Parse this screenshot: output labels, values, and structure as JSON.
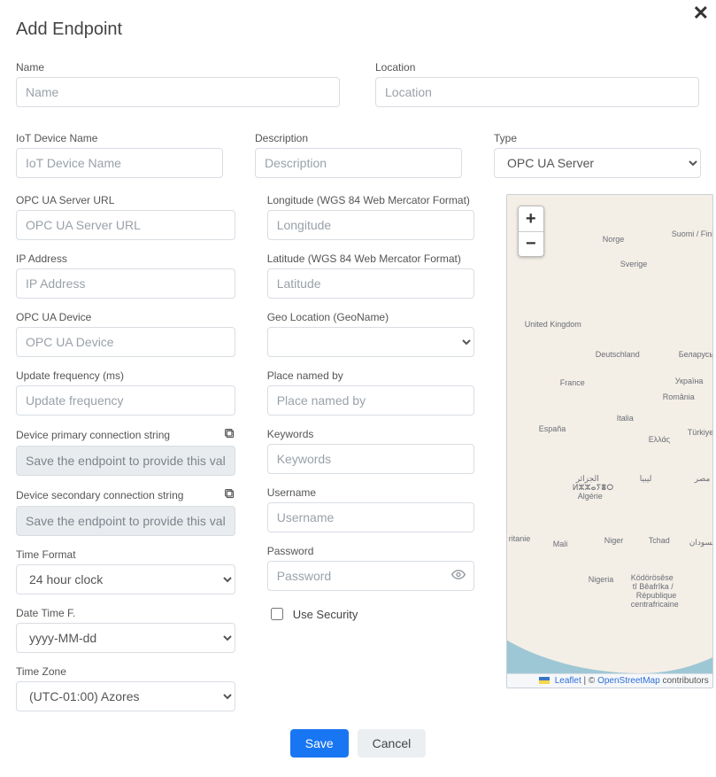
{
  "modal": {
    "title": "Add Endpoint"
  },
  "row1": {
    "name": {
      "label": "Name",
      "placeholder": "Name"
    },
    "location": {
      "label": "Location",
      "placeholder": "Location"
    }
  },
  "row2": {
    "iot": {
      "label": "IoT Device Name",
      "placeholder": "IoT Device Name"
    },
    "desc": {
      "label": "Description",
      "placeholder": "Description"
    },
    "type": {
      "label": "Type",
      "selected": "OPC UA Server"
    }
  },
  "left": {
    "url": {
      "label": "OPC UA Server URL",
      "placeholder": "OPC UA Server URL"
    },
    "ip": {
      "label": "IP Address",
      "placeholder": "IP Address"
    },
    "device": {
      "label": "OPC UA Device",
      "placeholder": "OPC UA Device"
    },
    "freq": {
      "label": "Update frequency (ms)",
      "placeholder": "Update frequency"
    },
    "prim": {
      "label": "Device primary connection string",
      "value": "Save the endpoint to provide this val"
    },
    "sec": {
      "label": "Device secondary connection string",
      "value": "Save the endpoint to provide this val"
    },
    "timefmt": {
      "label": "Time Format",
      "selected": "24 hour clock"
    },
    "datefmt": {
      "label": "Date Time F.",
      "selected": "yyyy-MM-dd"
    },
    "tz": {
      "label": "Time Zone",
      "selected": "(UTC-01:00) Azores"
    }
  },
  "mid": {
    "lon": {
      "label": "Longitude (WGS 84 Web Mercator Format)",
      "placeholder": "Longitude"
    },
    "lat": {
      "label": "Latitude (WGS 84 Web Mercator Format)",
      "placeholder": "Latitude"
    },
    "geo": {
      "label": "Geo Location (GeoName)"
    },
    "place": {
      "label": "Place named by",
      "placeholder": "Place named by"
    },
    "kw": {
      "label": "Keywords",
      "placeholder": "Keywords"
    },
    "user": {
      "label": "Username",
      "placeholder": "Username"
    },
    "pass": {
      "label": "Password",
      "placeholder": "Password"
    },
    "sec": {
      "label": "Use Security"
    }
  },
  "map": {
    "zoom_in": "+",
    "zoom_out": "−",
    "attrib_leaflet": "Leaflet",
    "attrib_sep": " | © ",
    "attrib_osm": "OpenStreetMap",
    "attrib_tail": " contributors",
    "labels": {
      "norge": "Norge",
      "suomi": "Suomi / Finland",
      "sverige": "Sverige",
      "uk": "United Kingdom",
      "de": "Deutschland",
      "be": "Беларусь",
      "fr": "France",
      "ua": "Україна",
      "ro": "România",
      "es": "España",
      "it": "Italia",
      "gr": "Ελλάς",
      "tr": "Türkiye",
      "dz_ar": "الجزائر",
      "dz_tif": "ⵍⵣⵣⴰⵢⴻⵔ",
      "dz_fr": "Algérie",
      "ly": "ليبيا",
      "eg": "مصر",
      "mr": "ritanie",
      "ml": "Mali",
      "ne": "Niger",
      "td": "Tchad",
      "sd": "السودان",
      "ng": "Nigeria",
      "cf1": "Ködörösêse",
      "cf2": "tî Bêafrîka /",
      "cf3": "République",
      "cf4": "centrafricaine"
    }
  },
  "footer": {
    "save": "Save",
    "cancel": "Cancel"
  }
}
